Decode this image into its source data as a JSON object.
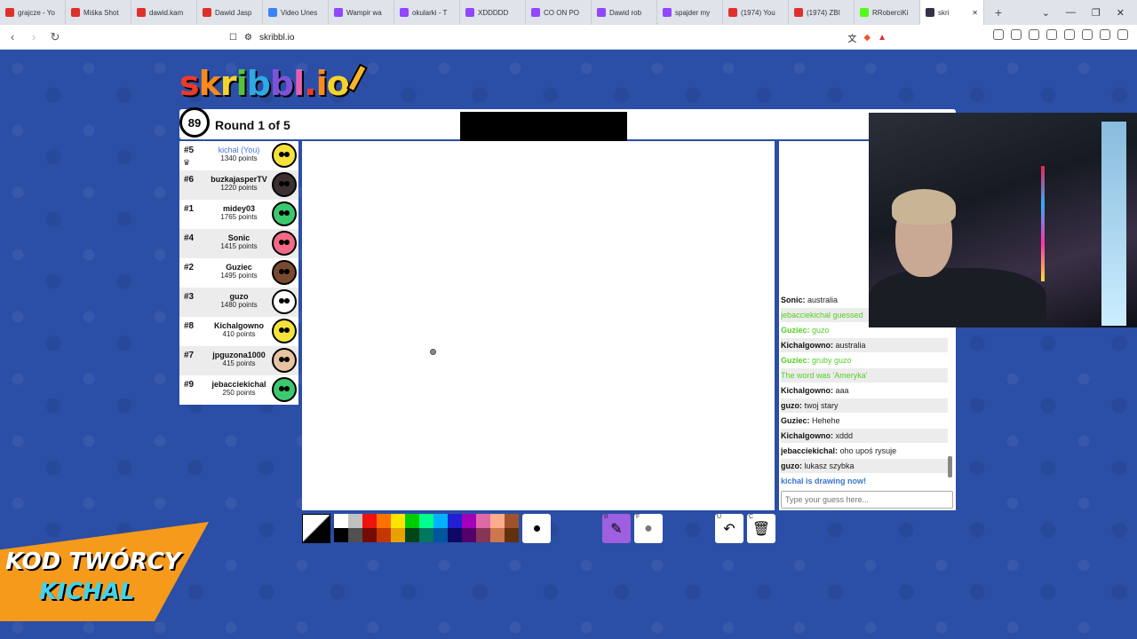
{
  "browser": {
    "tabs": [
      {
        "label": "grajcze - Yo",
        "icon": "youtube-icon",
        "color": "#e0302b"
      },
      {
        "label": "Miśka Shot",
        "icon": "youtube-icon",
        "color": "#e0302b"
      },
      {
        "label": "dawid.kam",
        "icon": "youtube-icon",
        "color": "#e0302b"
      },
      {
        "label": "Dawid Jasp",
        "icon": "youtube-icon",
        "color": "#e0302b"
      },
      {
        "label": "Video Unes",
        "icon": "video-icon",
        "color": "#3b82f6"
      },
      {
        "label": "Wampir wa",
        "icon": "twitch-icon",
        "color": "#9146ff"
      },
      {
        "label": "okularki - T",
        "icon": "twitch-icon",
        "color": "#9146ff"
      },
      {
        "label": "XDDDDD",
        "icon": "twitch-icon",
        "color": "#9146ff"
      },
      {
        "label": "CO ON PO",
        "icon": "twitch-icon",
        "color": "#9146ff"
      },
      {
        "label": "Dawid rob",
        "icon": "twitch-icon",
        "color": "#9146ff"
      },
      {
        "label": "spajder my",
        "icon": "twitch-icon",
        "color": "#9146ff"
      },
      {
        "label": "(1974) You",
        "icon": "youtube-icon",
        "color": "#e0302b"
      },
      {
        "label": "(1974) ZBI",
        "icon": "youtube-icon",
        "color": "#e0302b"
      },
      {
        "label": "RRoberciKi",
        "icon": "kick-icon",
        "color": "#53fc18"
      },
      {
        "label": "skri",
        "icon": "skribbl-icon",
        "color": "#334",
        "active": true
      }
    ],
    "url": "skribbl.io"
  },
  "logo": [
    "s",
    "k",
    "r",
    "i",
    "b",
    "b",
    "l",
    ".",
    "i",
    "o"
  ],
  "game": {
    "timer": "89",
    "round": "Round 1 of 5"
  },
  "players": [
    {
      "rank": "#5",
      "name": "kichal (You)",
      "points": "1340 points",
      "you": true,
      "crown": true,
      "avatar": "#f6e23c"
    },
    {
      "rank": "#6",
      "name": "buzkajasperTV",
      "points": "1220 points",
      "avatar": "#3c3030"
    },
    {
      "rank": "#1",
      "name": "midey03",
      "points": "1765 points",
      "avatar": "#3cc86e"
    },
    {
      "rank": "#4",
      "name": "Sonic",
      "points": "1415 points",
      "avatar": "#f26a86"
    },
    {
      "rank": "#2",
      "name": "Guziec",
      "points": "1495 points",
      "avatar": "#7a4a30"
    },
    {
      "rank": "#3",
      "name": "guzo",
      "points": "1480 points",
      "avatar": "#ffffff"
    },
    {
      "rank": "#8",
      "name": "Kichalgowno",
      "points": "410 points",
      "avatar": "#f6e23c"
    },
    {
      "rank": "#7",
      "name": "jpguzona1000",
      "points": "415 points",
      "avatar": "#e8c3a2"
    },
    {
      "rank": "#9",
      "name": "jebacciekichal",
      "points": "250 points",
      "avatar": "#3cc86e"
    }
  ],
  "chat": [
    {
      "user": "Sonic:",
      "text": "australia",
      "style": "normal"
    },
    {
      "user": "",
      "text": "jebacciekichal guessed",
      "style": "system"
    },
    {
      "user": "Guziec:",
      "text": "guzo",
      "style": "green"
    },
    {
      "user": "Kichalgowno:",
      "text": "australia",
      "style": "normal"
    },
    {
      "user": "Guziec:",
      "text": "gruby guzo",
      "style": "green"
    },
    {
      "user": "",
      "text": "The word was 'Ameryka'",
      "style": "system"
    },
    {
      "user": "Kichalgowno:",
      "text": "aaa",
      "style": "normal"
    },
    {
      "user": "guzo:",
      "text": "twoj stary",
      "style": "normal"
    },
    {
      "user": "Guziec:",
      "text": "Hehehe",
      "style": "normal"
    },
    {
      "user": "Kichalgowno:",
      "text": "xddd",
      "style": "normal"
    },
    {
      "user": "jebacciekichal:",
      "text": "oho upoś rysuje",
      "style": "normal"
    },
    {
      "user": "guzo:",
      "text": "lukasz szybka",
      "style": "normal"
    },
    {
      "user": "",
      "text": "kichal is drawing now!",
      "style": "blue"
    }
  ],
  "guess_placeholder": "Type your guess here...",
  "palette": [
    "#ffffff",
    "#c1c1c1",
    "#ef130b",
    "#ff7100",
    "#ffe400",
    "#00cc00",
    "#00ff91",
    "#00b2ff",
    "#231fd3",
    "#a300ba",
    "#df69a7",
    "#ffac8e",
    "#a0522d",
    "#000000",
    "#505050",
    "#740b07",
    "#c23800",
    "#e8a200",
    "#004619",
    "#00785d",
    "#00569e",
    "#0e0865",
    "#550069",
    "#873554",
    "#cc774d",
    "#63300d"
  ],
  "tools": {
    "brush_key": "B",
    "fill_key": "F",
    "undo_key": "U",
    "clear_key": "C"
  },
  "promo": {
    "line1": "KOD TWÓRCY",
    "line2": "KICHAL"
  }
}
